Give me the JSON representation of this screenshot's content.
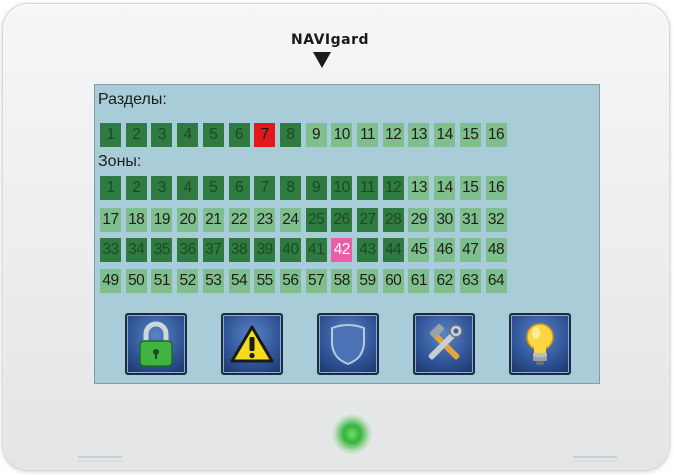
{
  "brand": {
    "logo_text": "NAVIgard"
  },
  "partitions": {
    "label": "Разделы:",
    "cells": [
      {
        "n": "1",
        "state": "dark"
      },
      {
        "n": "2",
        "state": "dark"
      },
      {
        "n": "3",
        "state": "dark"
      },
      {
        "n": "4",
        "state": "dark"
      },
      {
        "n": "5",
        "state": "dark"
      },
      {
        "n": "6",
        "state": "dark"
      },
      {
        "n": "7",
        "state": "alarm"
      },
      {
        "n": "8",
        "state": "dark"
      },
      {
        "n": "9",
        "state": "light"
      },
      {
        "n": "10",
        "state": "light"
      },
      {
        "n": "11",
        "state": "light"
      },
      {
        "n": "12",
        "state": "light"
      },
      {
        "n": "13",
        "state": "light"
      },
      {
        "n": "14",
        "state": "light"
      },
      {
        "n": "15",
        "state": "light"
      },
      {
        "n": "16",
        "state": "light"
      }
    ]
  },
  "zones": {
    "label": "Зоны:",
    "rows": [
      [
        {
          "n": "1",
          "state": "dark"
        },
        {
          "n": "2",
          "state": "dark"
        },
        {
          "n": "3",
          "state": "dark"
        },
        {
          "n": "4",
          "state": "dark"
        },
        {
          "n": "5",
          "state": "dark"
        },
        {
          "n": "6",
          "state": "dark"
        },
        {
          "n": "7",
          "state": "dark"
        },
        {
          "n": "8",
          "state": "dark"
        },
        {
          "n": "9",
          "state": "dark"
        },
        {
          "n": "10",
          "state": "dark"
        },
        {
          "n": "11",
          "state": "dark"
        },
        {
          "n": "12",
          "state": "dark"
        },
        {
          "n": "13",
          "state": "light"
        },
        {
          "n": "14",
          "state": "light"
        },
        {
          "n": "15",
          "state": "light"
        },
        {
          "n": "16",
          "state": "light"
        }
      ],
      [
        {
          "n": "17",
          "state": "light"
        },
        {
          "n": "18",
          "state": "light"
        },
        {
          "n": "19",
          "state": "light"
        },
        {
          "n": "20",
          "state": "light"
        },
        {
          "n": "21",
          "state": "light"
        },
        {
          "n": "22",
          "state": "light"
        },
        {
          "n": "23",
          "state": "light"
        },
        {
          "n": "24",
          "state": "light"
        },
        {
          "n": "25",
          "state": "dark"
        },
        {
          "n": "26",
          "state": "dark"
        },
        {
          "n": "27",
          "state": "dark"
        },
        {
          "n": "28",
          "state": "dark"
        },
        {
          "n": "29",
          "state": "light"
        },
        {
          "n": "30",
          "state": "light"
        },
        {
          "n": "31",
          "state": "light"
        },
        {
          "n": "32",
          "state": "light"
        }
      ],
      [
        {
          "n": "33",
          "state": "dark"
        },
        {
          "n": "34",
          "state": "dark"
        },
        {
          "n": "35",
          "state": "dark"
        },
        {
          "n": "36",
          "state": "dark"
        },
        {
          "n": "37",
          "state": "dark"
        },
        {
          "n": "38",
          "state": "dark"
        },
        {
          "n": "39",
          "state": "dark"
        },
        {
          "n": "40",
          "state": "dark"
        },
        {
          "n": "41",
          "state": "dark"
        },
        {
          "n": "42",
          "state": "pink"
        },
        {
          "n": "43",
          "state": "dark"
        },
        {
          "n": "44",
          "state": "dark"
        },
        {
          "n": "45",
          "state": "light"
        },
        {
          "n": "46",
          "state": "light"
        },
        {
          "n": "47",
          "state": "light"
        },
        {
          "n": "48",
          "state": "light"
        }
      ],
      [
        {
          "n": "49",
          "state": "light"
        },
        {
          "n": "50",
          "state": "light"
        },
        {
          "n": "51",
          "state": "light"
        },
        {
          "n": "52",
          "state": "light"
        },
        {
          "n": "53",
          "state": "light"
        },
        {
          "n": "54",
          "state": "light"
        },
        {
          "n": "55",
          "state": "light"
        },
        {
          "n": "56",
          "state": "light"
        },
        {
          "n": "57",
          "state": "light"
        },
        {
          "n": "58",
          "state": "light"
        },
        {
          "n": "59",
          "state": "light"
        },
        {
          "n": "60",
          "state": "light"
        },
        {
          "n": "61",
          "state": "light"
        },
        {
          "n": "62",
          "state": "light"
        },
        {
          "n": "63",
          "state": "light"
        },
        {
          "n": "64",
          "state": "light"
        }
      ]
    ]
  },
  "toolbar": {
    "buttons": [
      {
        "name": "lock-button",
        "icon": "padlock-icon"
      },
      {
        "name": "alarm-button",
        "icon": "warning-icon"
      },
      {
        "name": "security-button",
        "icon": "shield-icon"
      },
      {
        "name": "settings-button",
        "icon": "tools-icon"
      },
      {
        "name": "light-button",
        "icon": "lightbulb-icon"
      }
    ]
  },
  "colors": {
    "screen_bg": "#a8ccd8",
    "cell_light": "#7fbf8d",
    "cell_dark": "#2f7a40",
    "cell_alarm": "#e31818",
    "cell_pink": "#ea5da8",
    "led": "#35b33a"
  }
}
